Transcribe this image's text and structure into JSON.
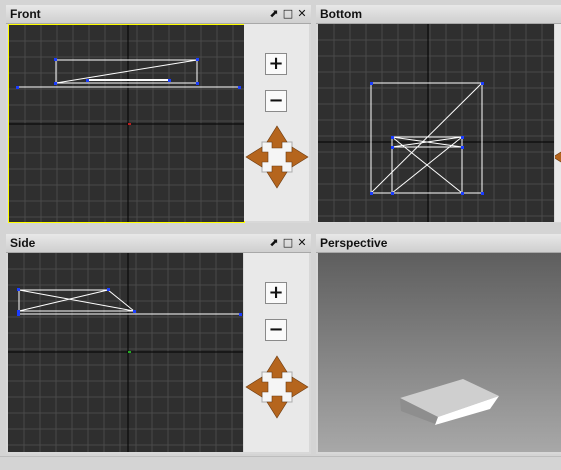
{
  "viewports": {
    "front": {
      "title": "Front"
    },
    "bottom": {
      "title": "Bottom"
    },
    "side": {
      "title": "Side"
    },
    "perspective": {
      "title": "Perspective"
    }
  },
  "window_controls": {
    "pin": "⬈",
    "maximize": "□",
    "close": "✕"
  },
  "navigation": {
    "zoom_in": "+",
    "zoom_out": "−"
  },
  "colors": {
    "viewport_bg": "#2f2f2f",
    "grid_minor": "#4a4a4a",
    "axis": "#000000",
    "wire": "#ffffff",
    "vertex": "#1a3cff",
    "active_border": "#ffff00",
    "perspective_bg": "#6a6a6a",
    "arrow": "#b5651d"
  }
}
